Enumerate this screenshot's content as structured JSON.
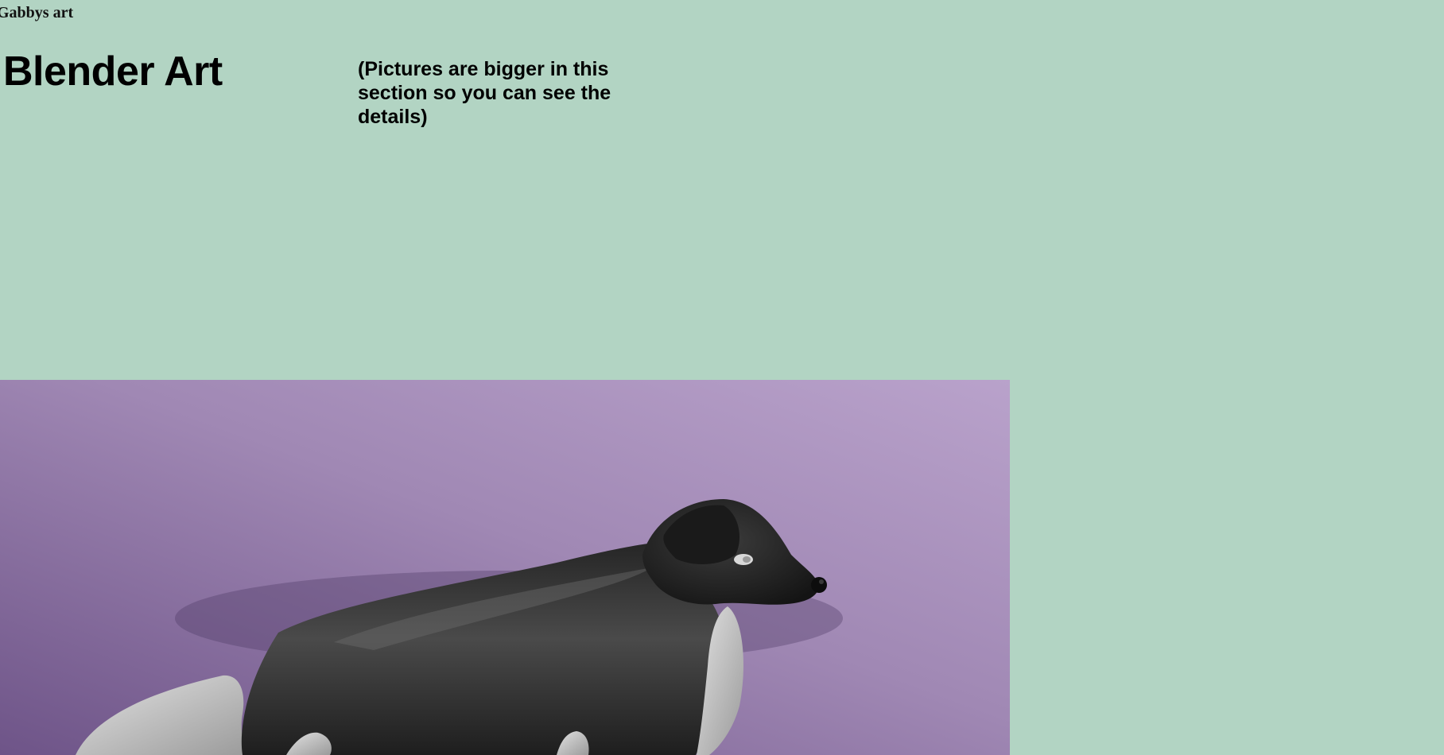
{
  "site": {
    "title": "Gabbys art"
  },
  "section": {
    "heading": "Blender Art",
    "note": "(Pictures are bigger in this section so you can see the details)"
  },
  "gallery": {
    "images": [
      {
        "subject": "black dog 3D render on purple background",
        "icon": "dog-render-image"
      }
    ]
  },
  "colors": {
    "page_background": "#b2d4c3",
    "render_background_dark": "#6e5488",
    "render_background_light": "#b9a2cb",
    "dog_body": "#2b2b2b",
    "dog_light_parts": "#c8c8c8"
  }
}
